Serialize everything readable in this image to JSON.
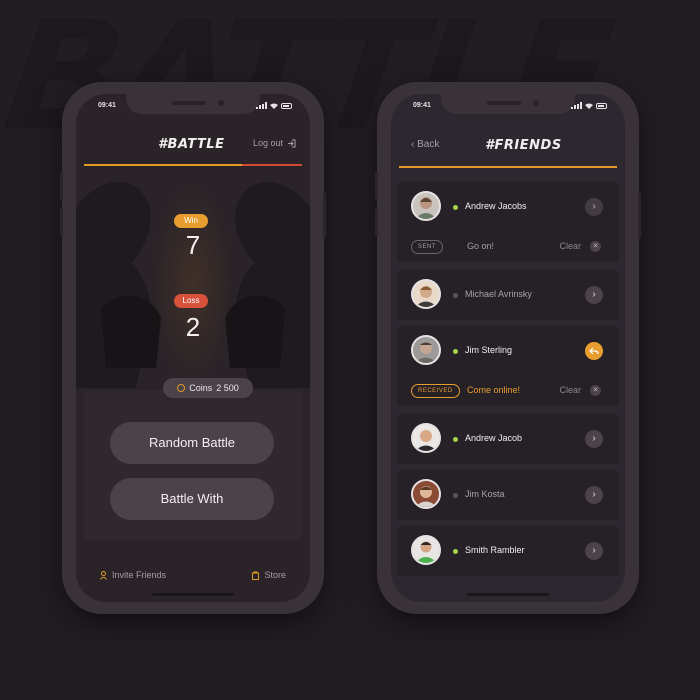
{
  "background_text": "BATTLE",
  "colors": {
    "accent": "#e89d2f",
    "loss": "#d8513a",
    "online": "#a6d44a",
    "offline": "#5d5558",
    "screen_bg": "#2a2428"
  },
  "battle_screen": {
    "status_time": "09:41",
    "title": "#BATTLE",
    "logout_label": "Log out",
    "logout_icon": "logout-icon",
    "win_label": "Win",
    "win_count": "7",
    "loss_label": "Loss",
    "loss_count": "2",
    "coins_label": "Coins",
    "coins_value": "2 500",
    "buttons": {
      "random_battle": "Random Battle",
      "battle_with": "Battle With"
    },
    "footer": {
      "invite_label": "Invite Friends",
      "invite_icon": "invite-icon",
      "store_label": "Store",
      "store_icon": "store-icon"
    }
  },
  "friends_screen": {
    "status_time": "09:41",
    "back_label": "Back",
    "title": "#FRIENDS",
    "friends": [
      {
        "name": "Andrew Jacobs",
        "online": true,
        "action": "chevron-right-icon"
      },
      {
        "name": "Michael Avrinsky",
        "online": false,
        "action": "chevron-right-icon"
      },
      {
        "name": "Jim Sterling",
        "online": true,
        "action": "reply-icon"
      },
      {
        "name": "Andrew Jacob",
        "online": true,
        "action": "chevron-right-icon"
      },
      {
        "name": "Jim Kosta",
        "online": false,
        "action": "chevron-right-icon"
      },
      {
        "name": "Smith Rambler",
        "online": true,
        "action": "chevron-right-icon"
      }
    ],
    "requests": {
      "sent": {
        "tag": "SENT",
        "message": "Go on!",
        "clear_label": "Clear"
      },
      "received": {
        "tag": "RECEIVED",
        "message": "Come online!",
        "clear_label": "Clear"
      }
    }
  }
}
